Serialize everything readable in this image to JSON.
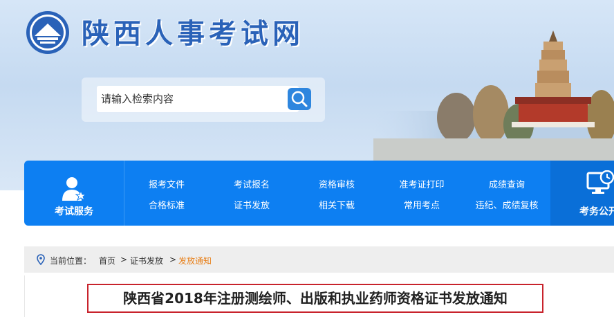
{
  "site": {
    "title": "陕西人事考试网"
  },
  "search": {
    "placeholder": "请输入检索内容"
  },
  "nav": {
    "service_label": "考试服务",
    "links": [
      [
        "报考文件",
        "合格标准"
      ],
      [
        "考试报名",
        "证书发放"
      ],
      [
        "资格审核",
        "相关下载"
      ],
      [
        "准考证打印",
        "常用考点"
      ],
      [
        "成绩查询",
        "违纪、成绩复核"
      ]
    ],
    "right_label": "考务公开"
  },
  "breadcrumb": {
    "prefix": "当前位置：",
    "home": "首页",
    "sep1": ">",
    "section": "证书发放",
    "sep2": ">",
    "current": "发放通知"
  },
  "article": {
    "title": "陕西省2018年注册测绘师、出版和执业药师资格证书发放通知"
  },
  "colors": {
    "nav_bg": "#0d7ff2",
    "brand_blue": "#2a62b8",
    "current_crumb": "#e8801a",
    "title_border": "#c8232c"
  },
  "icons": [
    "site-logo-icon",
    "search-icon",
    "user-service-icon",
    "monitor-clock-icon",
    "location-pin-icon"
  ]
}
